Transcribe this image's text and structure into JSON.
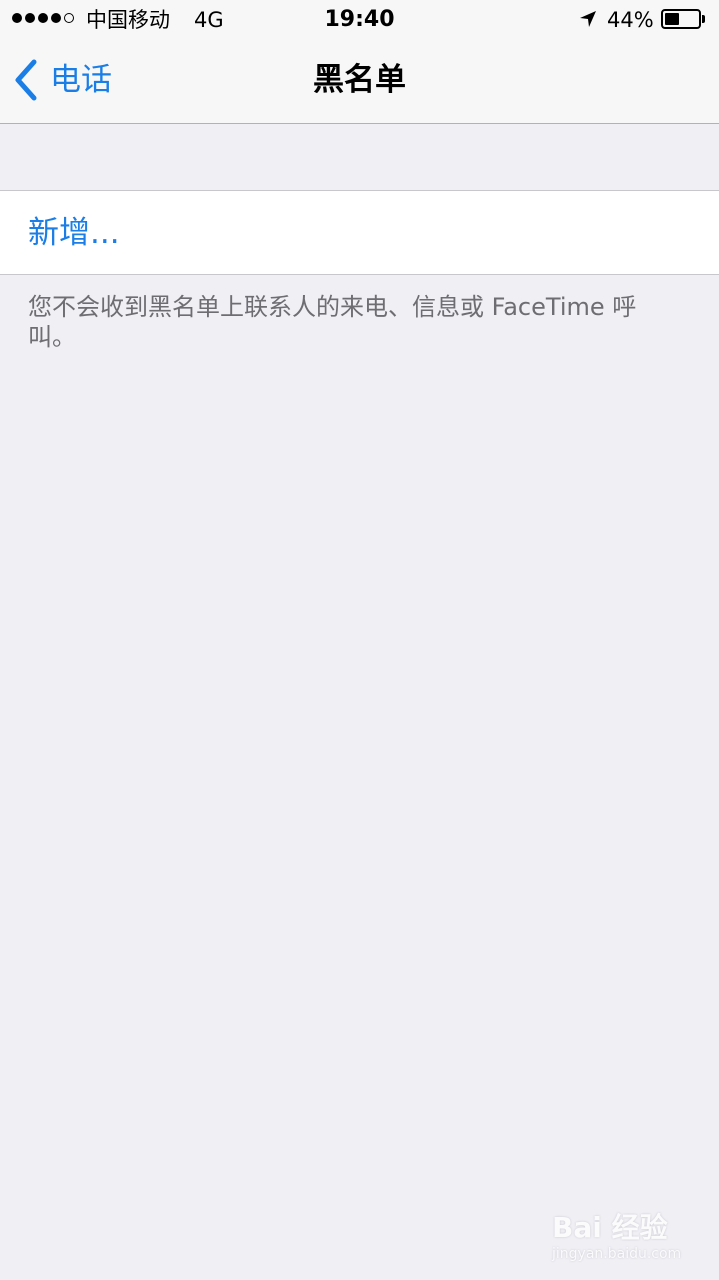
{
  "status_bar": {
    "signal_dots_filled": 4,
    "signal_dots_total": 5,
    "carrier": "中国移动",
    "network": "4G",
    "time": "19:40",
    "battery_percent_label": "44%",
    "battery_level": 0.44,
    "location_icon": "location-arrow-icon"
  },
  "nav": {
    "back_label": "电话",
    "back_icon": "chevron-left-icon",
    "title": "黑名单"
  },
  "list": {
    "add_label": "新增..."
  },
  "footer_note": "您不会收到黑名单上联系人的来电、信息或 FaceTime 呼叫。",
  "watermark": {
    "text": "Bai 经验",
    "sub": "jingyan.baidu.com"
  },
  "colors": {
    "accent": "#1a7ee6",
    "background": "#efeff4",
    "bar_background": "#f7f7f7",
    "secondary_text": "#6d6d72"
  }
}
